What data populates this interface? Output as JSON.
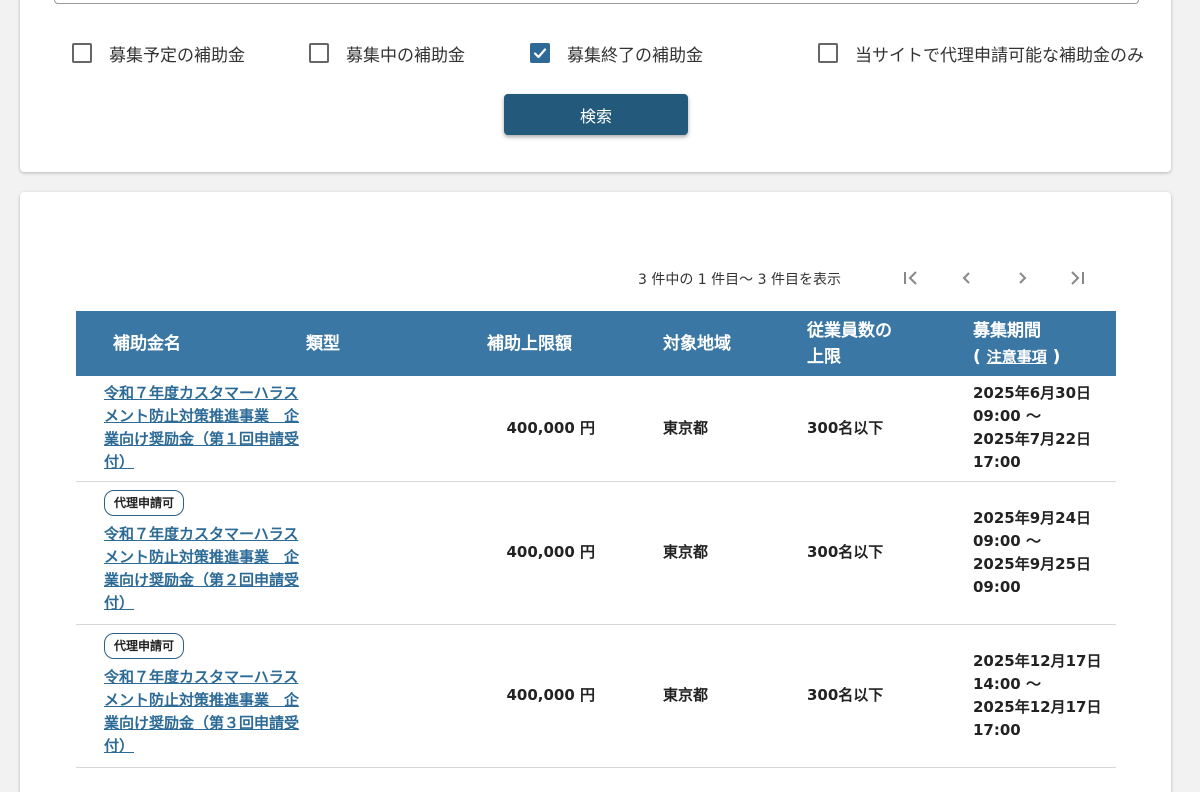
{
  "filters": [
    {
      "label": "募集予定の補助金",
      "checked": false
    },
    {
      "label": "募集中の補助金",
      "checked": false
    },
    {
      "label": "募集終了の補助金",
      "checked": true
    },
    {
      "label": "当サイトで代理申請可能な補助金のみ",
      "checked": false
    }
  ],
  "search_button": "検索",
  "pagination": {
    "summary": "3 件中の 1 件目～ 3 件目を表示",
    "first_icon": "first-page-icon",
    "prev_icon": "chevron-left-icon",
    "next_icon": "chevron-right-icon",
    "last_icon": "last-page-icon"
  },
  "table": {
    "headers": {
      "name": "補助金名",
      "type": "類型",
      "max_amount": "補助上限額",
      "region": "対象地域",
      "employees_line1": "従業員数の",
      "employees_line2": "上限",
      "period": "募集期間",
      "period_paren_open": "(",
      "period_note": "注意事項",
      "period_paren_close": ")"
    },
    "rows": [
      {
        "badge": "",
        "name_lines": [
          "令和７年度カスタマーハラス",
          "メント防止対策推進事業　企",
          "業向け奨励金（第１回申請受",
          "付）"
        ],
        "type": "",
        "amount": "400,000 円",
        "region": "東京都",
        "employees": "300名以下",
        "period_lines": [
          "2025年6月30日",
          "09:00 ～",
          "2025年7月22日",
          "17:00"
        ]
      },
      {
        "badge": "代理申請可",
        "name_lines": [
          "令和７年度カスタマーハラス",
          "メント防止対策推進事業　企",
          "業向け奨励金（第２回申請受",
          "付）"
        ],
        "type": "",
        "amount": "400,000 円",
        "region": "東京都",
        "employees": "300名以下",
        "period_lines": [
          "2025年9月24日",
          "09:00 ～",
          "2025年9月25日",
          "09:00"
        ]
      },
      {
        "badge": "代理申請可",
        "name_lines": [
          "令和７年度カスタマーハラス",
          "メント防止対策推進事業　企",
          "業向け奨励金（第３回申請受",
          "付）"
        ],
        "type": "",
        "amount": "400,000 円",
        "region": "東京都",
        "employees": "300名以下",
        "period_lines": [
          "2025年12月17日",
          "14:00 ～",
          "2025年12月17日",
          "17:00"
        ]
      }
    ]
  },
  "colors": {
    "header_bg": "#3a77a4",
    "button_bg": "#235a7c",
    "link": "#2d6b97",
    "checkbox_checked": "#2f6a97"
  }
}
